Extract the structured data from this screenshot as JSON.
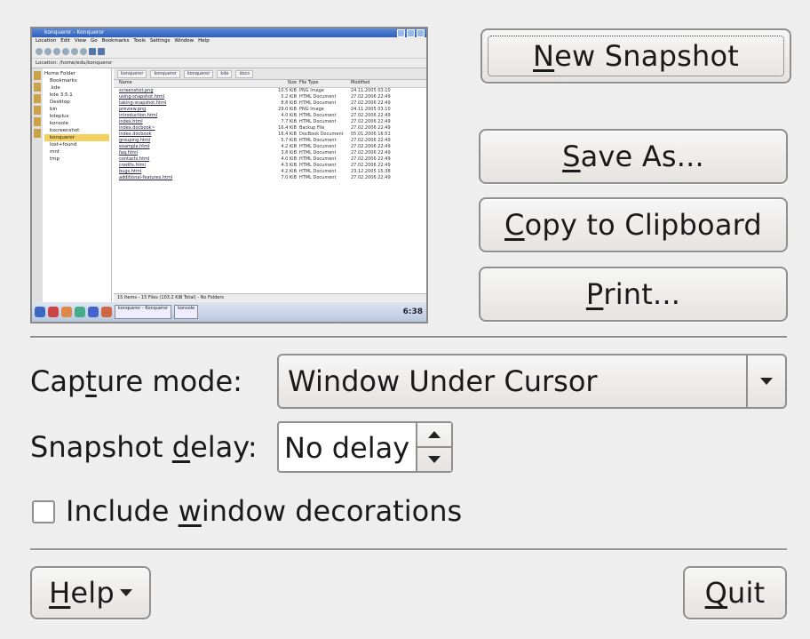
{
  "preview": {
    "window_title": "konqueror - Konqueror",
    "menubar": [
      "Location",
      "Edit",
      "View",
      "Go",
      "Bookmarks",
      "Tools",
      "Settings",
      "Window",
      "Help"
    ],
    "location_label": "Location:",
    "location_value": "/home/edu/konqueror",
    "tree": [
      {
        "label": "Home Folder",
        "selected": false
      },
      {
        "label": "Bookmarks",
        "selected": false
      },
      {
        "label": ".kde",
        "selected": false
      },
      {
        "label": "kde 3.5.1",
        "selected": false
      },
      {
        "label": "Desktop",
        "selected": false
      },
      {
        "label": "bin",
        "selected": false
      },
      {
        "label": "kdeplus",
        "selected": false
      },
      {
        "label": "konsole",
        "selected": false
      },
      {
        "label": "kscreenshot",
        "selected": false
      },
      {
        "label": "konqueror",
        "selected": true
      },
      {
        "label": "lost+found",
        "selected": false
      },
      {
        "label": "mnt",
        "selected": false
      },
      {
        "label": "tmp",
        "selected": false
      }
    ],
    "tabs": [
      "konqueror",
      "konqueror",
      "konqueror",
      "kde",
      "docs"
    ],
    "columns": [
      "Name",
      "Size",
      "File Type",
      "Modified"
    ],
    "files": [
      [
        "screenshot.png",
        "10.5 KiB",
        "PNG Image",
        "24.11.2005 03:10"
      ],
      [
        "using-snapshot.html",
        "5.2 KiB",
        "HTML Document",
        "27.02.2006 22:49"
      ],
      [
        "taking-snapshot.html",
        "8.8 KiB",
        "HTML Document",
        "27.02.2006 22:49"
      ],
      [
        "preview.png",
        "29.0 KiB",
        "PNG Image",
        "24.11.2005 03:10"
      ],
      [
        "introduction.html",
        "4.0 KiB",
        "HTML Document",
        "27.02.2006 22:49"
      ],
      [
        "index.html",
        "7.7 KiB",
        "HTML Document",
        "27.02.2006 22:49"
      ],
      [
        "index.docbook~",
        "16.4 KiB",
        "Backup File",
        "27.02.2006 22:49"
      ],
      [
        "index.docbook",
        "16.4 KiB",
        "DocBook Document",
        "05.01.2006 16:51"
      ],
      [
        "grouping.html",
        "5.7 KiB",
        "HTML Document",
        "27.02.2006 22:49"
      ],
      [
        "example.html",
        "4.2 KiB",
        "HTML Document",
        "27.02.2006 22:49"
      ],
      [
        "faq.html",
        "3.8 KiB",
        "HTML Document",
        "27.02.2006 22:49"
      ],
      [
        "contacts.html",
        "4.0 KiB",
        "HTML Document",
        "27.02.2006 22:49"
      ],
      [
        "credits.html",
        "4.3 KiB",
        "HTML Document",
        "27.02.2006 22:49"
      ],
      [
        "bugs.html",
        "4.2 KiB",
        "HTML Document",
        "23.12.2005 15:38"
      ],
      [
        "additional-features.html",
        "7.0 KiB",
        "HTML Document",
        "27.02.2006 22:49"
      ]
    ],
    "status": "15 Items - 15 Files (103.2 KiB Total) - No Folders",
    "taskbar_item": "konqueror - Konqueror",
    "taskbar_item2": "konsole",
    "clock": "6:38"
  },
  "buttons": {
    "new_snapshot": {
      "pre": "",
      "key": "N",
      "post": "ew Snapshot"
    },
    "save_as": {
      "pre": "",
      "key": "S",
      "post": "ave As..."
    },
    "copy": {
      "pre": "",
      "key": "C",
      "post": "opy to Clipboard"
    },
    "print": {
      "pre": "",
      "key": "P",
      "post": "rint..."
    },
    "help": {
      "pre": "",
      "key": "H",
      "post": "elp"
    },
    "quit": {
      "pre": "",
      "key": "Q",
      "post": "uit"
    }
  },
  "capture_mode": {
    "label_pre": "Cap",
    "label_key": "t",
    "label_post": "ure mode:",
    "value": "Window Under Cursor"
  },
  "snapshot_delay": {
    "label_pre": "Snapshot ",
    "label_key": "d",
    "label_post": "elay:",
    "value": "No delay"
  },
  "include_decorations": {
    "label_pre": "Include ",
    "label_key": "w",
    "label_post": "indow decorations",
    "checked": false
  }
}
